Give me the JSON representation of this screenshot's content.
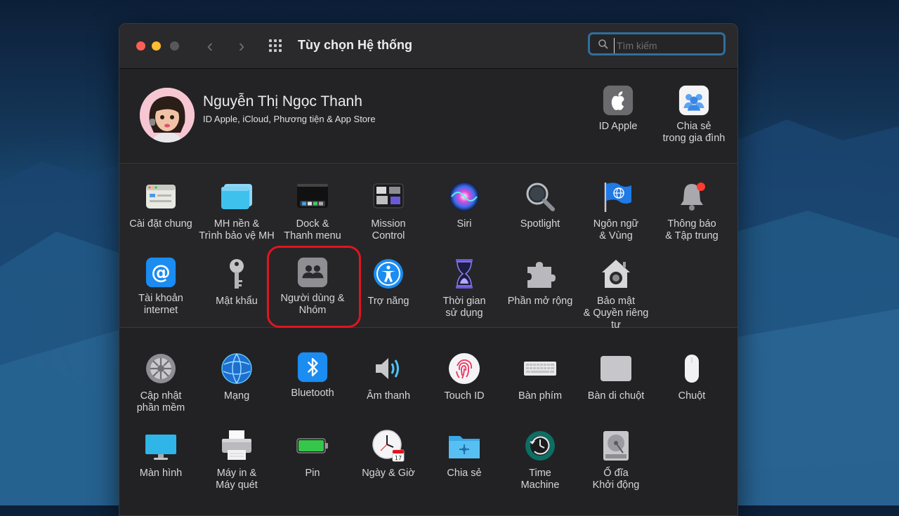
{
  "window": {
    "title": "Tùy chọn Hệ thống",
    "search_placeholder": "Tìm kiếm"
  },
  "account": {
    "name": "Nguyễn Thị Ngọc Thanh",
    "subtitle": "ID Apple, iCloud, Phương tiện & App Store",
    "items": [
      {
        "label": "ID Apple",
        "icon": "apple-logo-icon"
      },
      {
        "label": "Chia sẻ\ntrong gia đình",
        "icon": "family-sharing-icon"
      }
    ]
  },
  "row1": [
    {
      "label": "Cài đặt chung",
      "icon": "general-icon"
    },
    {
      "label": "MH nền &\nTrình bảo vệ MH",
      "icon": "desktop-screensaver-icon"
    },
    {
      "label": "Dock &\nThanh menu",
      "icon": "dock-icon"
    },
    {
      "label": "Mission\nControl",
      "icon": "mission-control-icon"
    },
    {
      "label": "Siri",
      "icon": "siri-icon"
    },
    {
      "label": "Spotlight",
      "icon": "spotlight-icon"
    },
    {
      "label": "Ngôn ngữ\n& Vùng",
      "icon": "language-region-icon"
    },
    {
      "label": "Thông báo\n& Tập trung",
      "icon": "notifications-icon"
    }
  ],
  "row2": [
    {
      "label": "Tài khoản\ninternet",
      "icon": "internet-accounts-icon"
    },
    {
      "label": "Mật khẩu",
      "icon": "passwords-icon"
    },
    {
      "label": "Người dùng &\nNhóm",
      "icon": "users-groups-icon"
    },
    {
      "label": "Trợ năng",
      "icon": "accessibility-icon"
    },
    {
      "label": "Thời gian\nsử dụng",
      "icon": "screen-time-icon"
    },
    {
      "label": "Phần mở rộng",
      "icon": "extensions-icon"
    },
    {
      "label": "Bảo mật\n& Quyền riêng tư",
      "icon": "security-privacy-icon"
    }
  ],
  "row3": [
    {
      "label": "Cập nhật\nphần mềm",
      "icon": "software-update-icon"
    },
    {
      "label": "Mạng",
      "icon": "network-icon"
    },
    {
      "label": "Bluetooth",
      "icon": "bluetooth-icon"
    },
    {
      "label": "Âm thanh",
      "icon": "sound-icon"
    },
    {
      "label": "Touch ID",
      "icon": "touch-id-icon"
    },
    {
      "label": "Bàn phím",
      "icon": "keyboard-icon"
    },
    {
      "label": "Bàn di chuột",
      "icon": "trackpad-icon"
    },
    {
      "label": "Chuột",
      "icon": "mouse-icon"
    }
  ],
  "row4": [
    {
      "label": "Màn hình",
      "icon": "displays-icon"
    },
    {
      "label": "Máy in &\nMáy quét",
      "icon": "printers-scanners-icon"
    },
    {
      "label": "Pin",
      "icon": "battery-icon"
    },
    {
      "label": "Ngày & Giờ",
      "icon": "date-time-icon"
    },
    {
      "label": "Chia sẻ",
      "icon": "sharing-icon"
    },
    {
      "label": "Time\nMachine",
      "icon": "time-machine-icon"
    },
    {
      "label": "Ổ đĩa\nKhởi động",
      "icon": "startup-disk-icon"
    }
  ],
  "colors": {
    "accent": "#2f6f9e",
    "highlight_ring": "#e0151f",
    "window_bg": "#1e1e20"
  }
}
